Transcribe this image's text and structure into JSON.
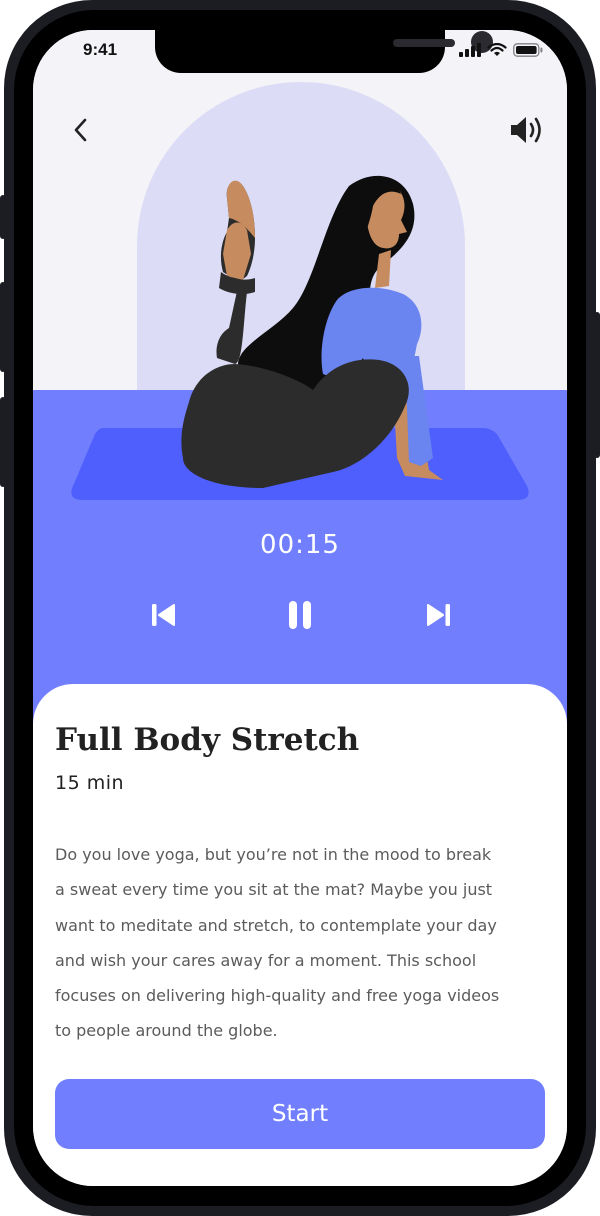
{
  "status_bar": {
    "time": "9:41"
  },
  "player": {
    "timer": "00:15",
    "controls": {
      "previous_icon": "skip-previous-icon",
      "pause_icon": "pause-icon",
      "next_icon": "skip-next-icon"
    }
  },
  "header": {
    "back_icon": "chevron-left-icon",
    "sound_icon": "volume-icon"
  },
  "workout": {
    "title": "Full Body Stretch",
    "duration": "15 min",
    "description_lines": [
      "Do you love yoga, but you’re not in the mood to break",
      "a sweat every time you sit at the mat? Maybe you just",
      "want to meditate and stretch, to contemplate your day",
      "and wish your cares away for a moment. This school",
      "focuses on delivering high-quality and free yoga videos",
      "to people around the globe."
    ],
    "start_label": "Start"
  },
  "colors": {
    "accent": "#717ffe",
    "hero_background": "#f3f3f8",
    "arch": "#dcdcf6",
    "mat": "#4f5ffd",
    "shirt": "#6a85f0",
    "skin": "#c68b5e",
    "hair": "#0d0d0d",
    "leggings": "#2c2c2c"
  }
}
